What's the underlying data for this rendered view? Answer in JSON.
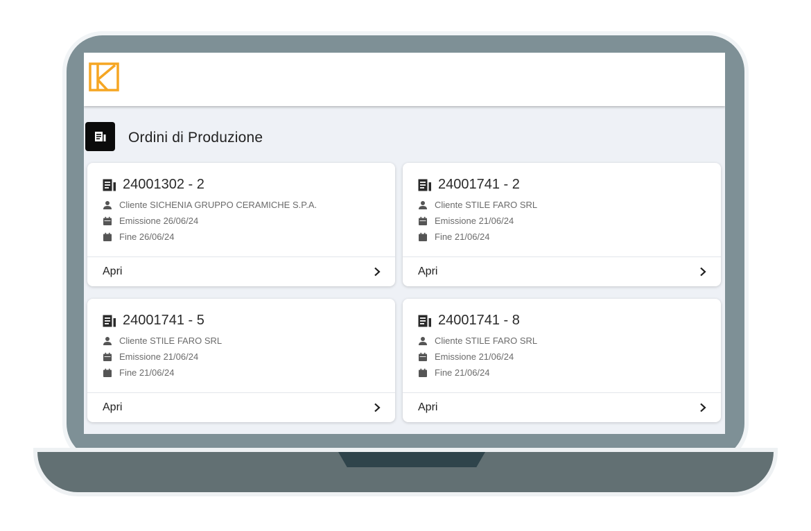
{
  "section": {
    "title": "Ordini di Produzione",
    "icon": "receipt-icon"
  },
  "orders": [
    {
      "code": "24001302 - 2",
      "customer": "Cliente SICHENIA GRUPPO CERAMICHE S.P.A.",
      "issued": "Emissione 26/06/24",
      "end": "Fine 26/06/24",
      "action": "Apri"
    },
    {
      "code": "24001741 - 2",
      "customer": "Cliente STILE FARO SRL",
      "issued": "Emissione 21/06/24",
      "end": "Fine 21/06/24",
      "action": "Apri"
    },
    {
      "code": "24001741 - 5",
      "customer": "Cliente STILE FARO SRL",
      "issued": "Emissione 21/06/24",
      "end": "Fine 21/06/24",
      "action": "Apri"
    },
    {
      "code": "24001741 - 8",
      "customer": "Cliente STILE FARO SRL",
      "issued": "Emissione 21/06/24",
      "end": "Fine 21/06/24",
      "action": "Apri"
    }
  ],
  "colors": {
    "brand_accent": "#f5a623",
    "screen_background": "#eef1f6",
    "laptop_frame": "#7e9096"
  }
}
